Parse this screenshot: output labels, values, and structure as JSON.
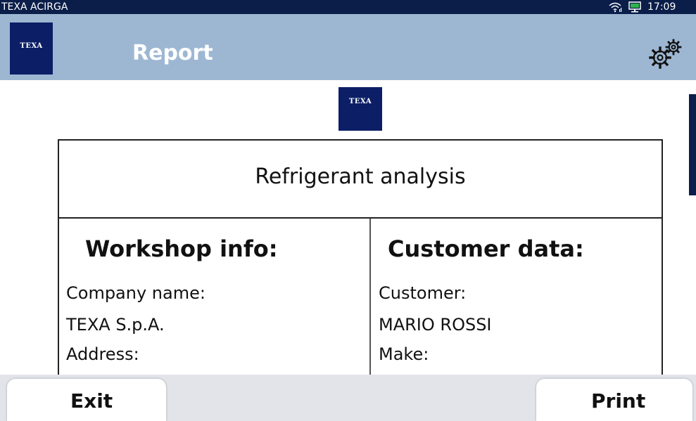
{
  "status_bar": {
    "app_name": "TEXA ACIRGA",
    "time": "17:09",
    "wifi_icon": "wifi-icon",
    "network_icon": "network-icon",
    "background_color": "#0b1e4a"
  },
  "header": {
    "logo_text": "TEXA",
    "title": "Report",
    "settings_icon": "gears-icon",
    "background_color": "#9db7d3"
  },
  "report": {
    "logo_text": "TEXA",
    "title": "Refrigerant analysis",
    "workshop": {
      "heading": "Workshop info:",
      "fields": [
        "Company name:",
        "TEXA S.p.A.",
        "Address:"
      ]
    },
    "customer": {
      "heading": "Customer data:",
      "fields": [
        "Customer:",
        "MARIO ROSSI",
        "Make:"
      ]
    }
  },
  "footer": {
    "exit_label": "Exit",
    "print_label": "Print"
  },
  "colors": {
    "brand_navy": "#0c1e66",
    "footer_bg": "#e2e4ea"
  }
}
